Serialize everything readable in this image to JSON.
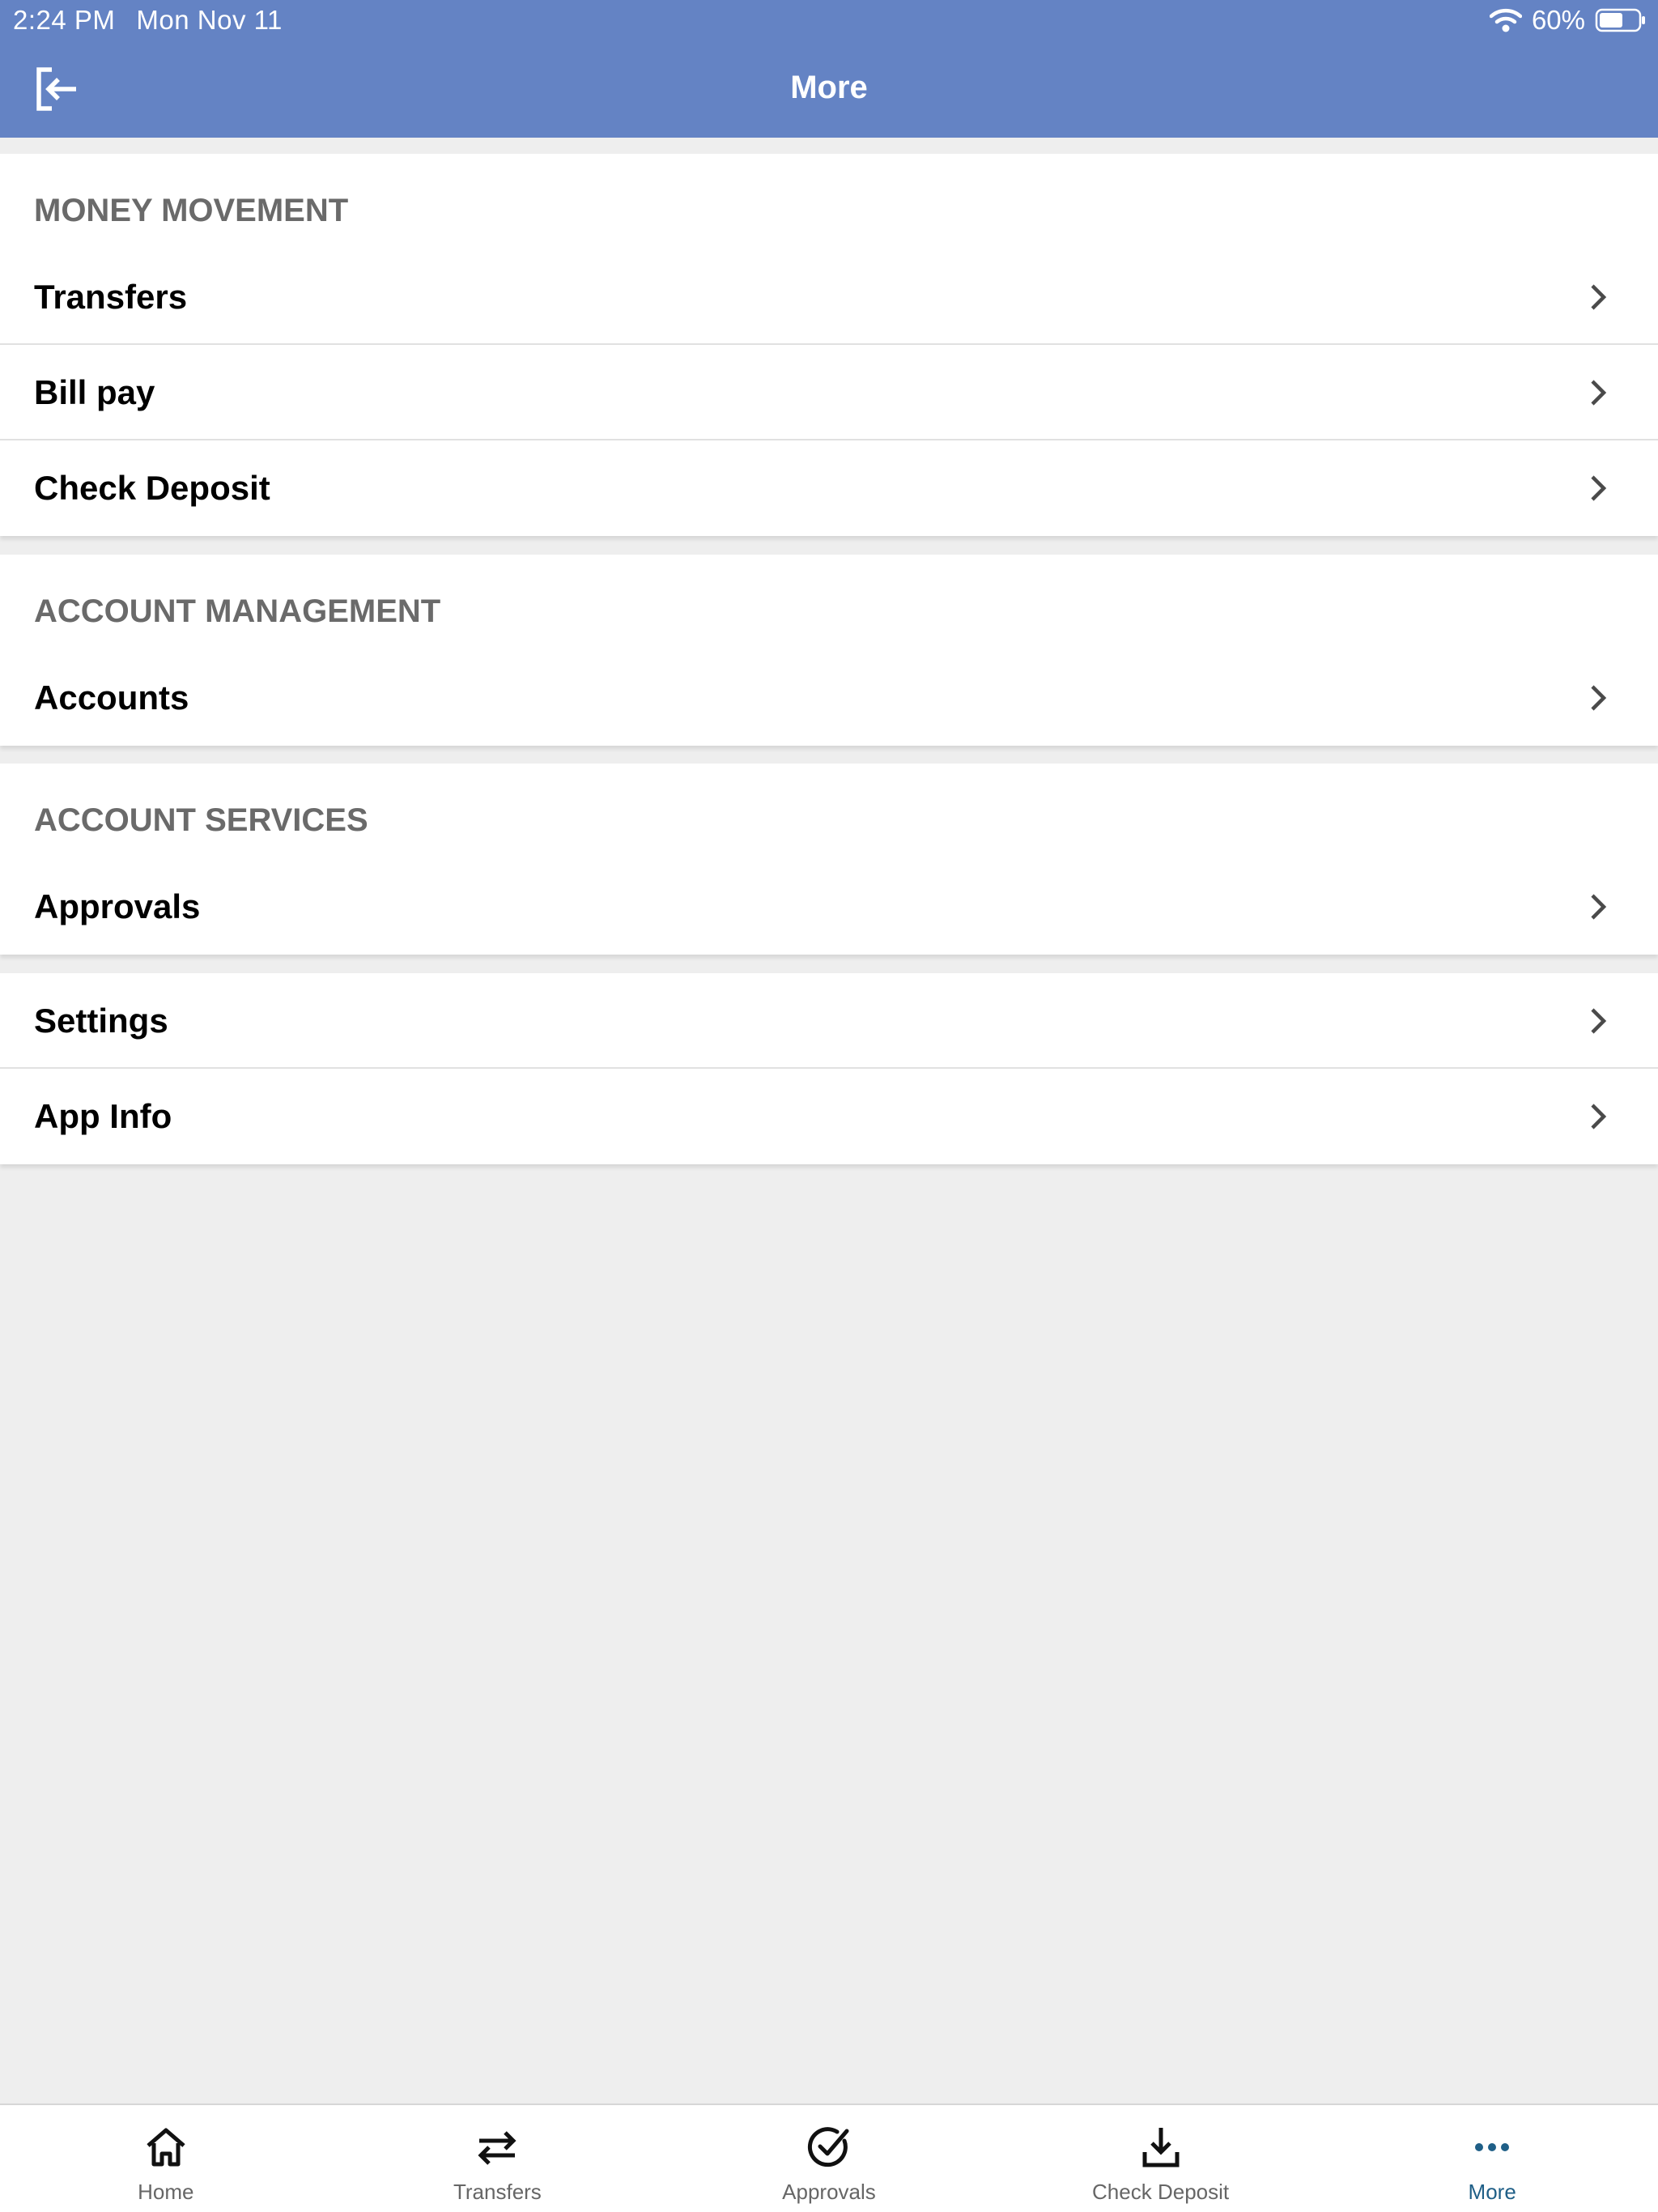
{
  "status": {
    "time": "2:24 PM",
    "date": "Mon Nov 11",
    "battery": "60%"
  },
  "header": {
    "title": "More"
  },
  "groups": [
    {
      "header": "MONEY MOVEMENT",
      "items": [
        "Transfers",
        "Bill pay",
        "Check Deposit"
      ]
    },
    {
      "header": "ACCOUNT MANAGEMENT",
      "items": [
        "Accounts"
      ]
    },
    {
      "header": "ACCOUNT SERVICES",
      "items": [
        "Approvals"
      ]
    },
    {
      "header": "",
      "items": [
        "Settings",
        "App Info"
      ]
    }
  ],
  "tabs": [
    {
      "label": "Home",
      "icon": "home-icon"
    },
    {
      "label": "Transfers",
      "icon": "arrows-icon"
    },
    {
      "label": "Approvals",
      "icon": "check-circle-icon"
    },
    {
      "label": "Check Deposit",
      "icon": "download-icon"
    },
    {
      "label": "More",
      "icon": "more-icon",
      "active": true
    }
  ],
  "colors": {
    "header_bg": "#6483c4",
    "active_tab": "#1f5f87",
    "page_bg": "#eeeeee"
  }
}
